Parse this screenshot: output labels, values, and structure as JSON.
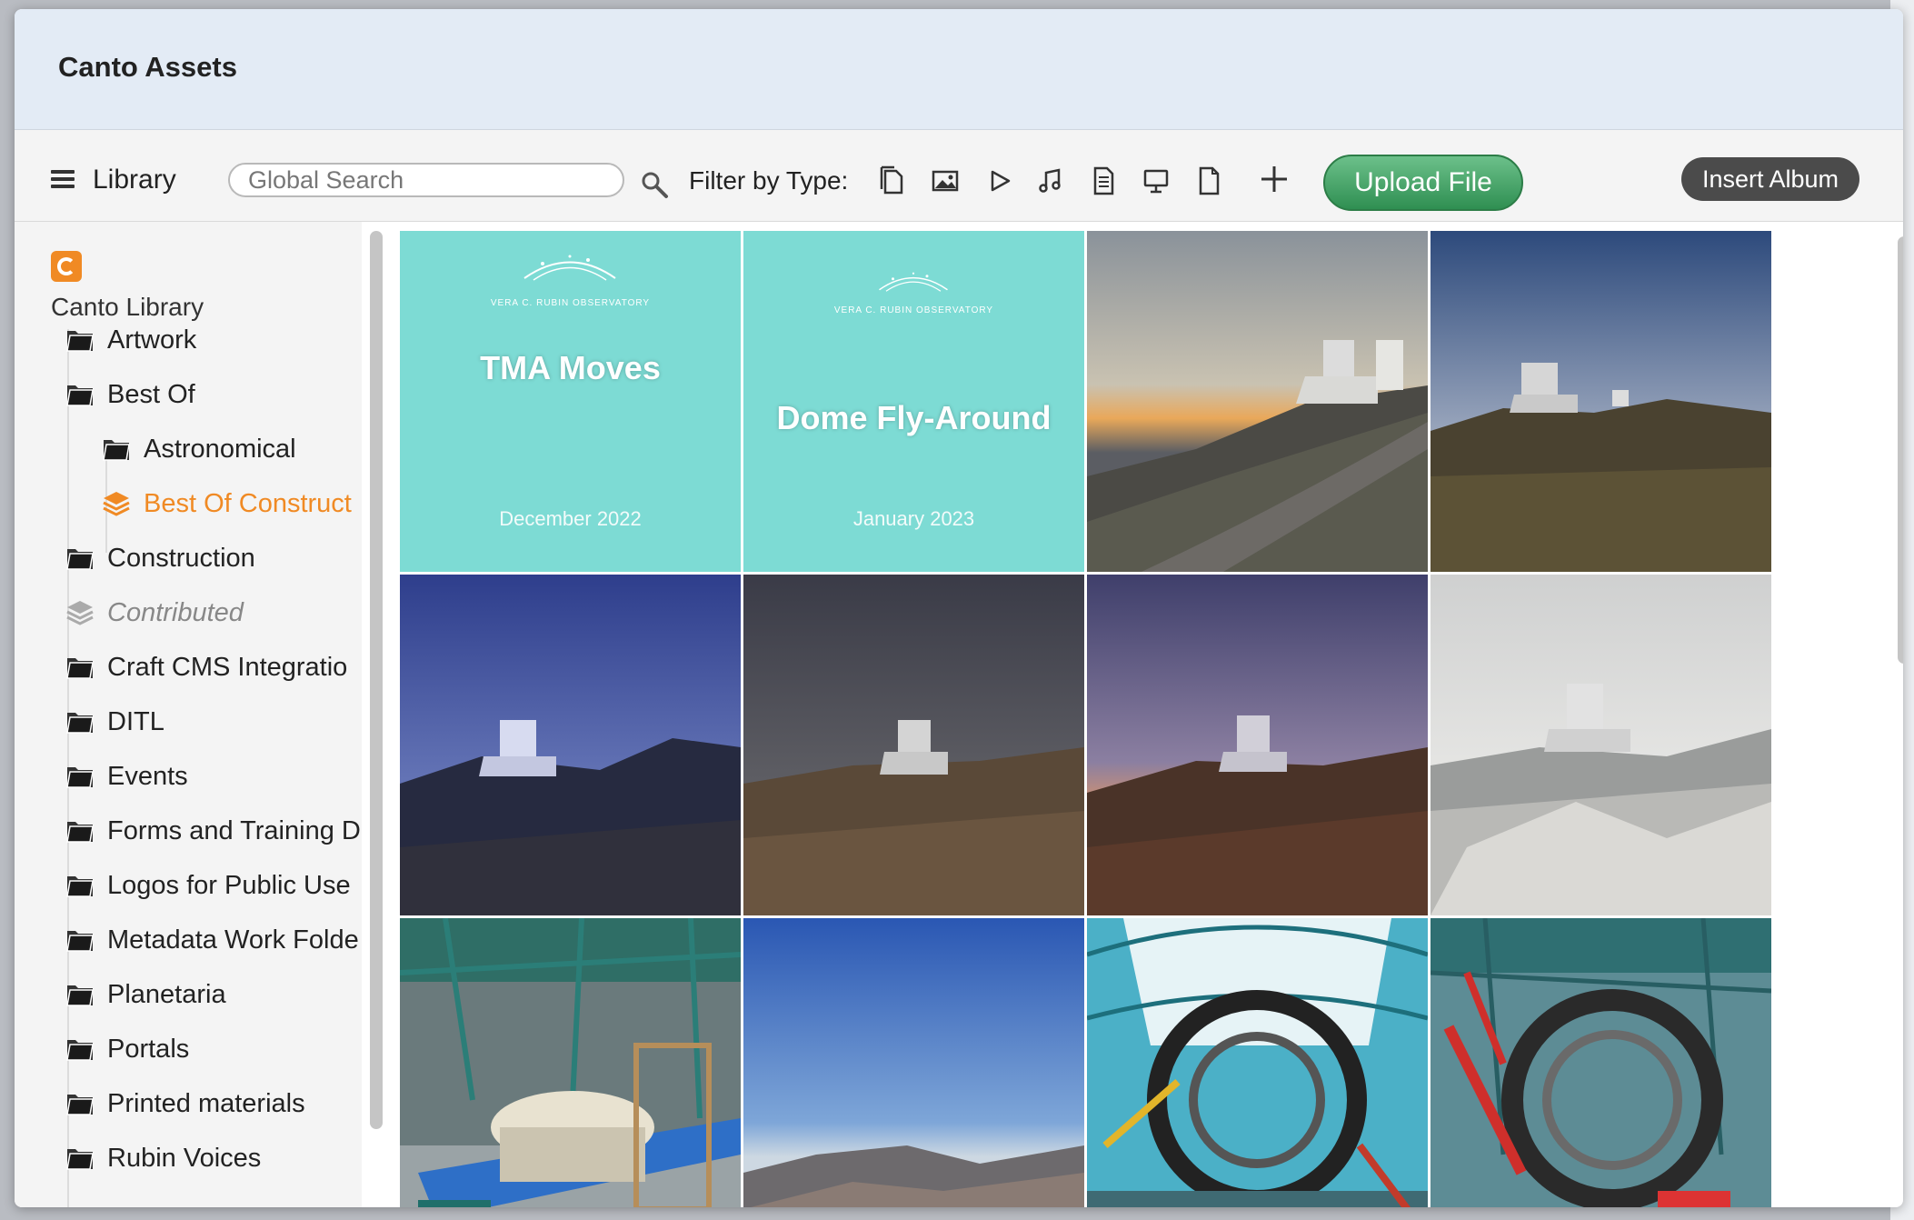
{
  "app": {
    "title": "Canto Assets"
  },
  "toolbar": {
    "library_label": "Library",
    "search_placeholder": "Global Search",
    "filter_label": "Filter by Type:",
    "filter_types": [
      "all-documents-icon",
      "image-icon",
      "video-icon",
      "audio-icon",
      "text-document-icon",
      "presentation-icon",
      "other-file-icon"
    ],
    "upload_label": "Upload File",
    "insert_album_label": "Insert Album",
    "accent_color": "#3a9b5c"
  },
  "sidebar": {
    "root_label": "Canto Library",
    "items": [
      {
        "label": "Artwork"
      },
      {
        "label": "Best Of"
      },
      {
        "label": "Astronomical"
      },
      {
        "label": "Best Of Construct"
      },
      {
        "label": "Construction"
      },
      {
        "label": "Contributed"
      },
      {
        "label": "Craft CMS Integratio"
      },
      {
        "label": "DITL"
      },
      {
        "label": "Events"
      },
      {
        "label": "Forms and Training D"
      },
      {
        "label": "Logos for Public Use"
      },
      {
        "label": "Metadata Work Folde"
      },
      {
        "label": "Planetaria"
      },
      {
        "label": "Portals"
      },
      {
        "label": "Printed materials"
      },
      {
        "label": "Rubin Voices"
      }
    ],
    "active_color": "#f08a24"
  },
  "grid": {
    "tiles": [
      {
        "kind": "video-title",
        "title": "TMA Moves",
        "date": "December 2022",
        "logo_text": "VERA C. RUBIN OBSERVATORY"
      },
      {
        "kind": "video-title",
        "title": "Dome Fly-Around",
        "date": "January 2023",
        "logo_text": "VERA C. RUBIN OBSERVATORY"
      },
      {
        "kind": "photo",
        "subject": "observatory-at-sunset"
      },
      {
        "kind": "photo",
        "subject": "observatory-daylight"
      },
      {
        "kind": "photo",
        "subject": "observatory-blue-dusk"
      },
      {
        "kind": "photo",
        "subject": "observatory-night"
      },
      {
        "kind": "photo",
        "subject": "observatory-twilight"
      },
      {
        "kind": "photo",
        "subject": "observatory-snow"
      },
      {
        "kind": "photo",
        "subject": "camera-assembly-interior"
      },
      {
        "kind": "photo",
        "subject": "mountain-sky"
      },
      {
        "kind": "photo",
        "subject": "telescope-mount-fisheye"
      },
      {
        "kind": "photo",
        "subject": "telescope-mount-interior"
      }
    ]
  }
}
